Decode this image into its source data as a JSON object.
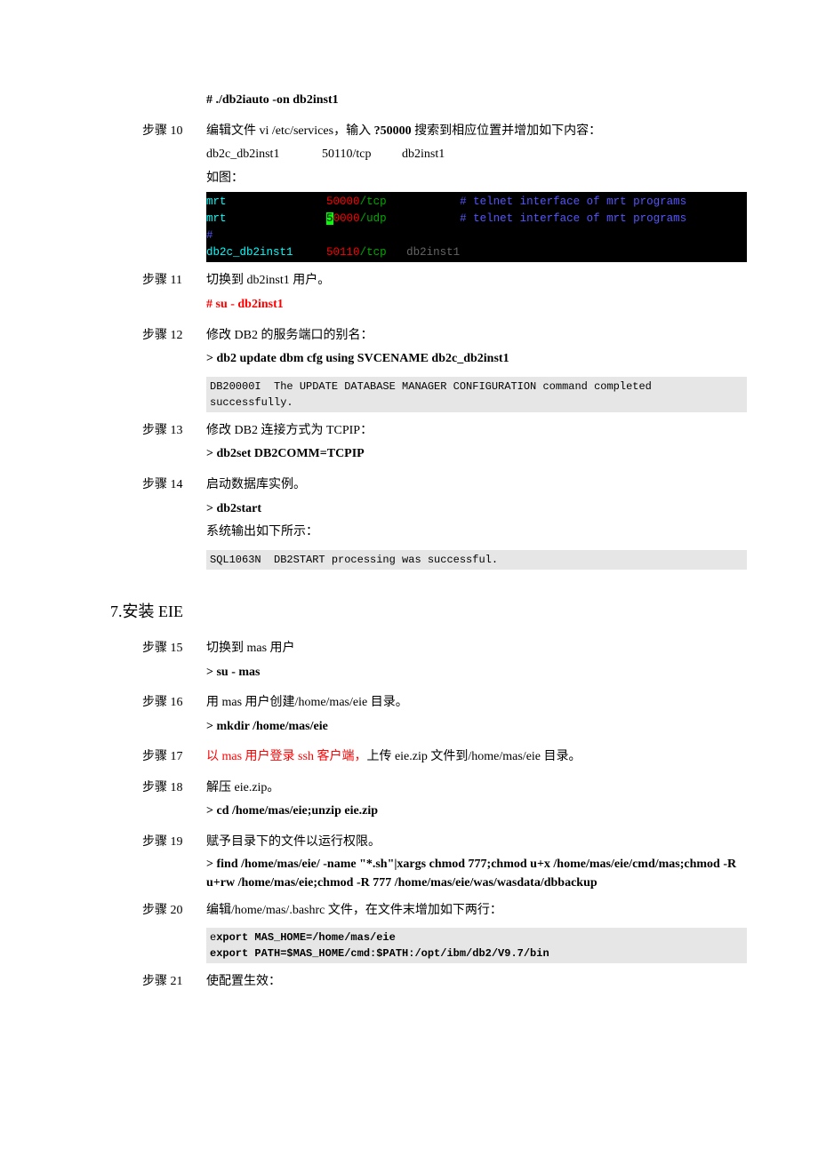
{
  "pre_cmd": "# ./db2iauto -on db2inst1",
  "step10": {
    "label": "步骤 10",
    "desc_a": "编辑文件 vi /etc/services，输入 ",
    "desc_b": "?50000",
    "desc_c": " 搜索到相应位置并增加如下内容：",
    "line2_a": "db2c_db2inst1",
    "line2_b": "50110/tcp",
    "line2_c": "db2inst1",
    "line3": "如图：",
    "term": {
      "r1_a": "mrt",
      "r1_b": "50000",
      "r1_c": "/tcp",
      "r1_d": "# telnet interface of mrt programs",
      "r2_a": "mrt",
      "r2_b": "5",
      "r2_c": "0000",
      "r2_d": "/udp",
      "r2_e": "# telnet interface of mrt programs",
      "r3": "#",
      "r4_a": "db2c_db2inst1",
      "r4_b": "50110",
      "r4_c": "/tcp",
      "r4_d": "db2inst1"
    }
  },
  "step11": {
    "label": "步骤 11",
    "desc": "切换到 db2inst1 用户。",
    "cmd": "# su - db2inst1"
  },
  "step12": {
    "label": "步骤 12",
    "desc": "修改 DB2 的服务端口的别名：",
    "cmd": "> db2 update dbm cfg using SVCENAME db2c_db2inst1",
    "out": "DB20000I  The UPDATE DATABASE MANAGER CONFIGURATION command completed\nsuccessfully."
  },
  "step13": {
    "label": "步骤 13",
    "desc": "修改 DB2 连接方式为 TCPIP：",
    "cmd": "> db2set DB2COMM=TCPIP"
  },
  "step14": {
    "label": "步骤 14",
    "desc": "启动数据库实例。",
    "cmd": "> db2start",
    "note": "系统输出如下所示：",
    "out": "SQL1063N  DB2START processing was successful."
  },
  "section7": "7.安装 EIE",
  "step15": {
    "label": "步骤 15",
    "desc": "切换到 mas 用户",
    "cmd": "> su - mas"
  },
  "step16": {
    "label": "步骤 16",
    "desc": "用 mas 用户创建/home/mas/eie 目录。",
    "cmd": "> mkdir /home/mas/eie"
  },
  "step17": {
    "label": "步骤 17",
    "desc_red": "以 mas 用户登录 ssh 客户端，",
    "desc_rest": "上传 eie.zip 文件到/home/mas/eie 目录。"
  },
  "step18": {
    "label": "步骤 18",
    "desc": "解压 eie.zip。",
    "cmd": "> cd /home/mas/eie;unzip eie.zip"
  },
  "step19": {
    "label": "步骤 19",
    "desc": "赋予目录下的文件以运行权限。",
    "cmd": "> find /home/mas/eie/ -name \"*.sh\"|xargs chmod 777;chmod u+x /home/mas/eie/cmd/mas;chmod -R u+rw /home/mas/eie;chmod -R 777 /home/mas/eie/was/wasdata/dbbackup"
  },
  "step20": {
    "label": "步骤 20",
    "desc": "编辑/home/mas/.bashrc 文件，在文件末增加如下两行：",
    "out_a": "e",
    "out_b": "xport MAS_HOME=/home/mas/eie\nexport PATH=$MAS_HOME/cmd:$PATH:/opt/ibm/db2/V9.7/bin"
  },
  "step21": {
    "label": "步骤 21",
    "desc": "使配置生效："
  }
}
